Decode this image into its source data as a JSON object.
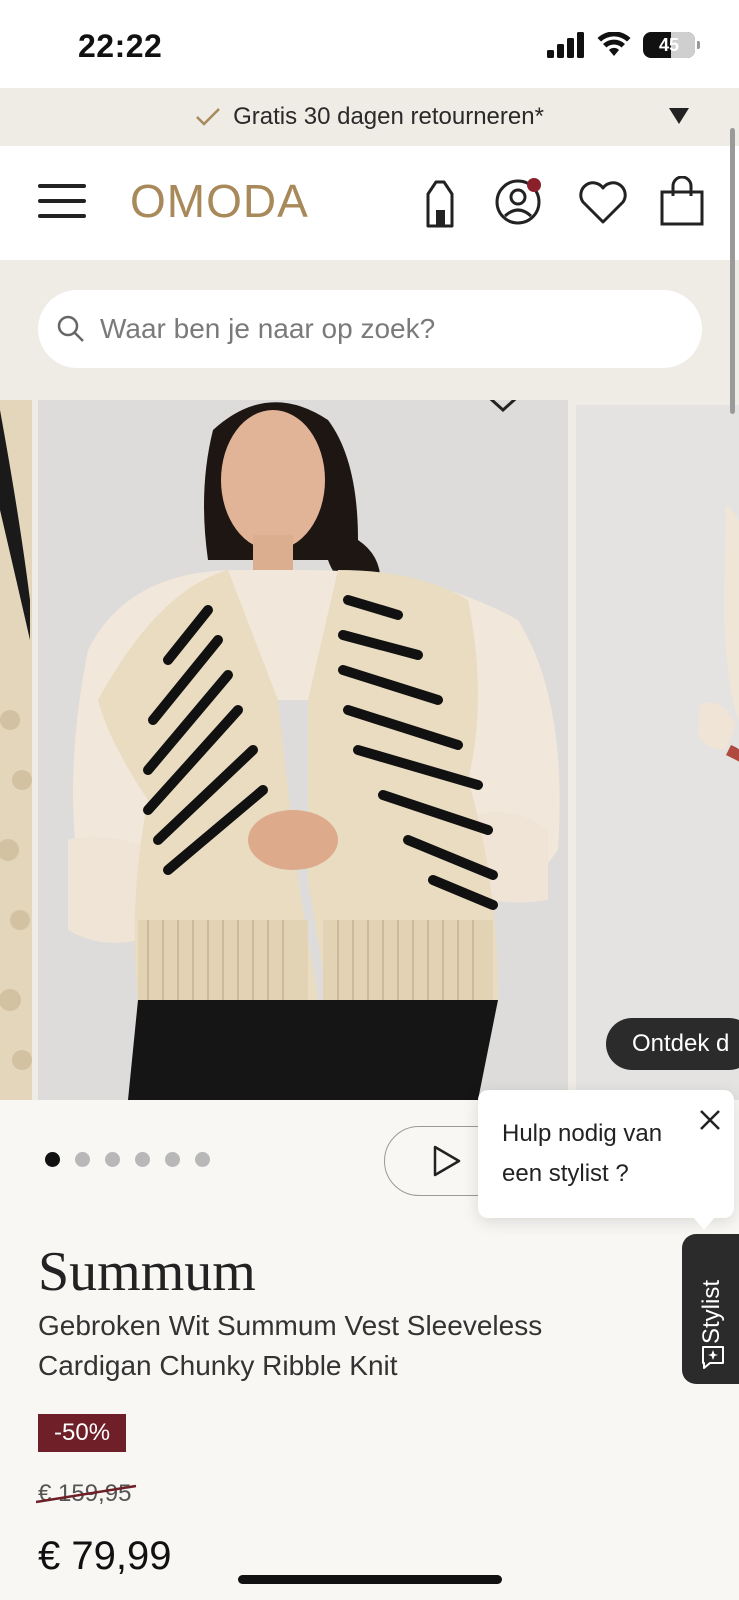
{
  "status_bar": {
    "time": "22:22",
    "battery": "45"
  },
  "promo": {
    "text": "Gratis 30 dagen retourneren*"
  },
  "header": {
    "logo": "OMODA"
  },
  "search": {
    "placeholder": "Waar ben je naar op zoek?"
  },
  "gallery": {
    "slide_count": 6,
    "active_slide": 1,
    "explore_label": "Ontdek d"
  },
  "stylist": {
    "popup_text": "Hulp nodig van een stylist ?",
    "tab_label": "Stylist"
  },
  "product": {
    "brand": "Summum",
    "name": "Gebroken Wit Summum Vest Sleeveless Cardigan Chunky Ribble Knit",
    "discount": "-50%",
    "old_price": "€ 159,95",
    "price": "€ 79,99"
  },
  "colors": {
    "logo_gold": "#a8895a",
    "discount_bg": "#6e1f27",
    "promo_bg": "#efebe5",
    "dark": "#2b2b2b"
  }
}
